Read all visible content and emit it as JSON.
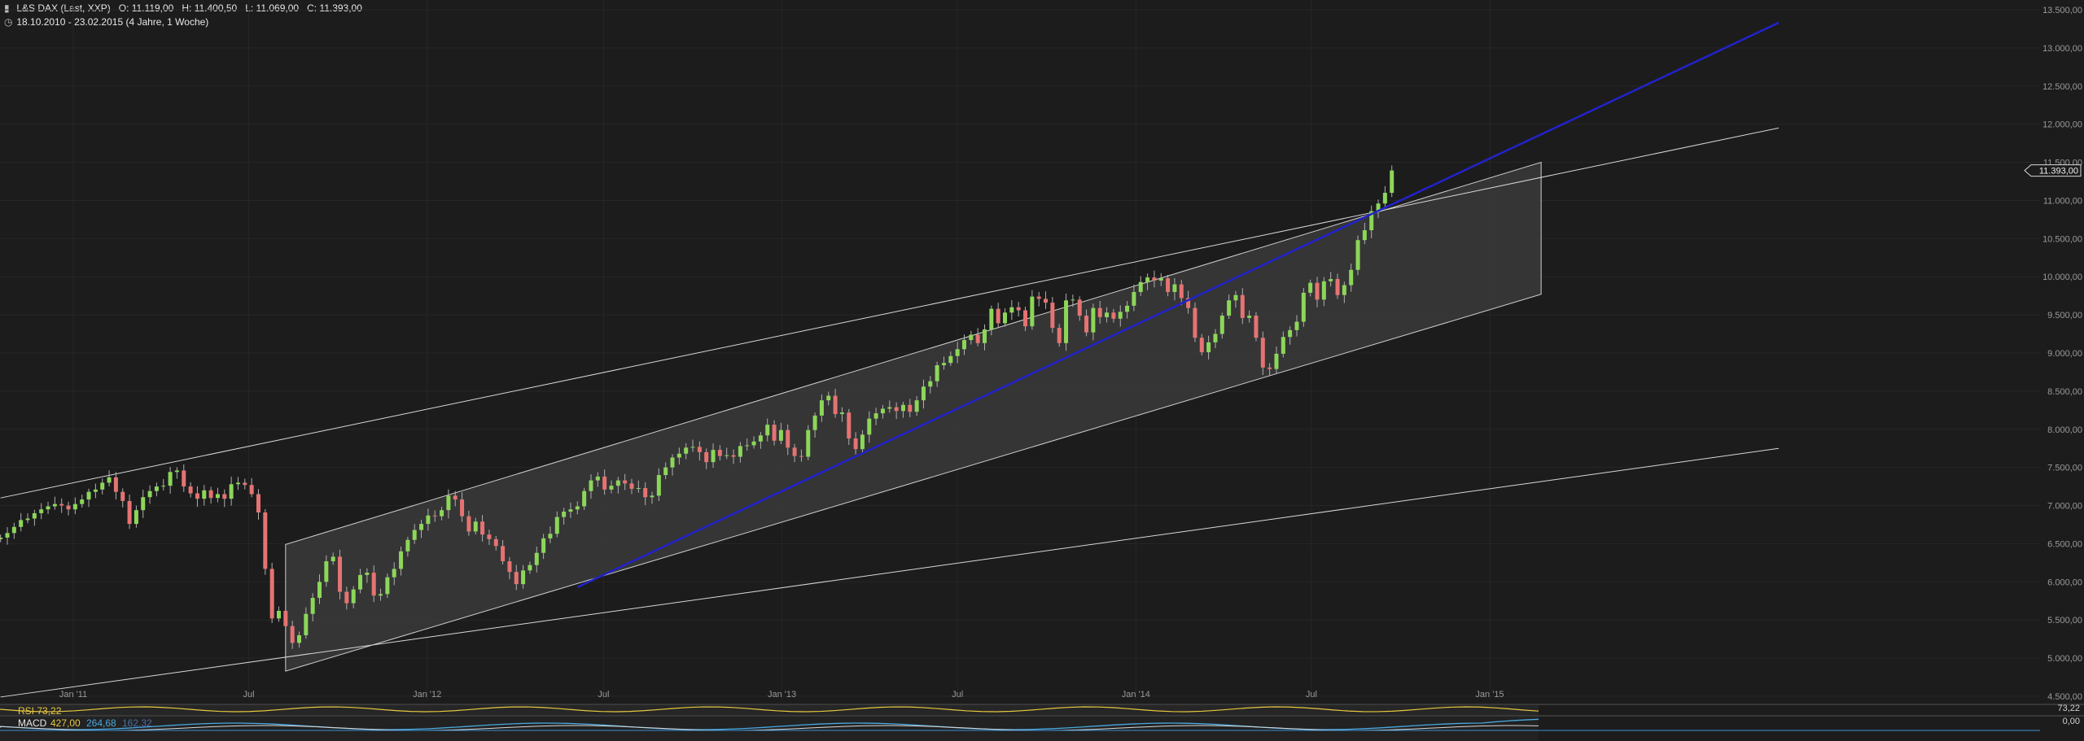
{
  "header": {
    "instrument": "L&S DAX (Last, XXP)",
    "open": "O: 11.119,00",
    "high": "H: 11.400,50",
    "low": "L: 11.069,00",
    "close": "C: 11.393,00",
    "period": "18.10.2010 - 23.02.2015 (4 Jahre, 1 Woche)",
    "chart_icon": "candlestick-icon",
    "clock_icon": "clock-icon"
  },
  "last_price_label": "11.393,00",
  "indicators": {
    "rsi_label": "RSI 73,22",
    "macd_label": "MACD",
    "macd_value": "427,00",
    "macd_signal": "264,68",
    "macd_hist": "162,32",
    "rsi_right": "73,22",
    "macd_zero": "0,00"
  },
  "colors": {
    "background": "#1c1c1c",
    "bull": "#8cd65a",
    "bear": "#e57373",
    "trend_blue": "#2222cc",
    "channel_fill": "#3a3a3a",
    "line_white": "#d8d8d8",
    "rsi_line": "#e8c840",
    "macd_line": "#4aa8e0"
  },
  "chart_data": {
    "type": "candlestick",
    "title": "L&S DAX (Last, XXP)",
    "x_range": [
      "2010-10-18",
      "2015-02-23"
    ],
    "y_range": [
      4500,
      13500
    ],
    "y_ticks": [
      "4.500,00",
      "5.000,00",
      "5.500,00",
      "6.000,00",
      "6.500,00",
      "7.000,00",
      "7.500,00",
      "8.000,00",
      "8.500,00",
      "9.000,00",
      "9.500,00",
      "10.000,00",
      "10.500,00",
      "11.000,00",
      "11.500,00",
      "12.000,00",
      "12.500,00",
      "13.000,00",
      "13.500,00"
    ],
    "y_tick_values": [
      4500,
      5000,
      5500,
      6000,
      6500,
      7000,
      7500,
      8000,
      8500,
      9000,
      9500,
      10000,
      10500,
      11000,
      11500,
      12000,
      12500,
      13000,
      13500
    ],
    "x_ticks": [
      "Jan '11",
      "Jul",
      "Jan '12",
      "Jul",
      "Jan '13",
      "Jul",
      "Jan '14",
      "Jul",
      "Jan '15"
    ],
    "x_tick_dates": [
      "2011-01-01",
      "2011-07-01",
      "2012-01-01",
      "2012-07-01",
      "2013-01-01",
      "2013-07-01",
      "2014-01-01",
      "2014-07-01",
      "2015-01-01"
    ],
    "weekly_close": [
      6580,
      6640,
      6720,
      6810,
      6830,
      6900,
      6950,
      6990,
      7020,
      7000,
      6950,
      7020,
      7080,
      7180,
      7210,
      7300,
      7370,
      7180,
      7060,
      6760,
      6940,
      7110,
      7190,
      7250,
      7260,
      7440,
      7460,
      7250,
      7160,
      7090,
      7200,
      7100,
      7150,
      7090,
      7280,
      7300,
      7270,
      7150,
      6910,
      6170,
      5520,
      5620,
      5420,
      5200,
      5300,
      5580,
      5790,
      6000,
      6270,
      6330,
      5870,
      5720,
      5900,
      6090,
      6120,
      5820,
      5840,
      6060,
      6170,
      6400,
      6550,
      6680,
      6760,
      6870,
      6860,
      6940,
      7130,
      7080,
      6860,
      6660,
      6790,
      6620,
      6560,
      6470,
      6270,
      6130,
      5970,
      6150,
      6220,
      6380,
      6570,
      6630,
      6850,
      6920,
      6950,
      6990,
      7190,
      7330,
      7380,
      7210,
      7260,
      7330,
      7290,
      7220,
      7230,
      7110,
      7130,
      7400,
      7500,
      7630,
      7680,
      7760,
      7770,
      7700,
      7570,
      7730,
      7650,
      7660,
      7640,
      7780,
      7790,
      7840,
      7920,
      8060,
      7850,
      7990,
      7760,
      7650,
      7640,
      7990,
      8180,
      8380,
      8440,
      8200,
      8220,
      7880,
      7740,
      7930,
      8140,
      8210,
      8270,
      8290,
      8240,
      8320,
      8230,
      8380,
      8560,
      8630,
      8840,
      8870,
      8960,
      9050,
      9170,
      9240,
      9130,
      9310,
      9580,
      9390,
      9530,
      9600,
      9560,
      9350,
      9740,
      9710,
      9660,
      9330,
      9130,
      9690,
      9700,
      9490,
      9270,
      9590,
      9470,
      9530,
      9450,
      9540,
      9620,
      9800,
      9930,
      9990,
      9950,
      9980,
      9800,
      9900,
      9720,
      9590,
      9200,
      9010,
      9140,
      9250,
      9490,
      9690,
      9760,
      9460,
      9490,
      9200,
      8810,
      8790,
      8990,
      9210,
      9300,
      9410,
      9790,
      9920,
      9700,
      9940,
      9970,
      9760,
      9890,
      10090,
      10480,
      10610,
      10860,
      10960,
      11100,
      11393
    ],
    "channel": {
      "upper": [
        [
          "2011-08-08",
          6490
        ],
        [
          "2015-02-23",
          11500
        ]
      ],
      "lower": [
        [
          "2011-08-08",
          4830
        ],
        [
          "2015-02-23",
          9770
        ]
      ]
    },
    "blue_trend": [
      [
        "2012-06-04",
        5930
      ],
      [
        "2015-10-26",
        13330
      ]
    ],
    "long_line_upper": [
      [
        "2010-10-18",
        7100
      ],
      [
        "2015-10-26",
        11950
      ]
    ],
    "long_line_lower": [
      [
        "2010-10-18",
        4490
      ],
      [
        "2015-10-26",
        7750
      ]
    ],
    "grid": true,
    "last_price": 11393
  }
}
